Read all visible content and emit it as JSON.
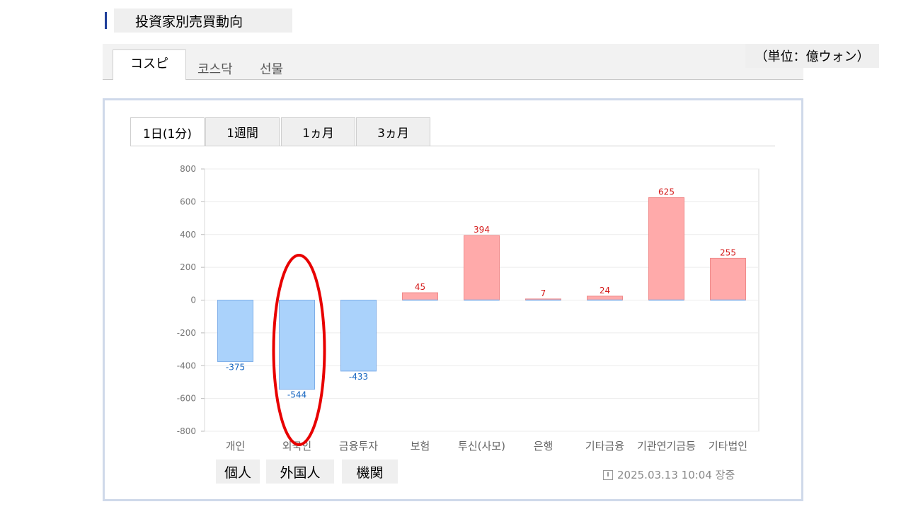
{
  "header": {
    "title": "投資家別売買動向"
  },
  "market_tabs": [
    {
      "label": "コスピ",
      "active": true
    },
    {
      "label": "코스닥",
      "active": false
    },
    {
      "label": "선물",
      "active": false
    }
  ],
  "unit_label": "（単位：億ウォン）",
  "period_tabs": [
    {
      "label": "1日(1分)",
      "active": true
    },
    {
      "label": "1週間",
      "active": false
    },
    {
      "label": "1ヵ月",
      "active": false
    },
    {
      "label": "3ヵ月",
      "active": false
    }
  ],
  "chart_data": {
    "type": "bar",
    "categories": [
      "개인",
      "외국인",
      "금융투자",
      "보험",
      "투신(사모)",
      "은행",
      "기타금융",
      "기관연기금등",
      "기타법인"
    ],
    "values": [
      -375,
      -544,
      -433,
      45,
      394,
      7,
      24,
      625,
      255
    ],
    "ylim": [
      -800,
      800
    ],
    "yticks": [
      800,
      600,
      400,
      200,
      0,
      -200,
      -400,
      -600,
      -800
    ],
    "grid": true,
    "colors": {
      "positive_fill": "#ffaaaa",
      "positive_stroke": "#f08a8a",
      "negative_fill": "#aad2fb",
      "negative_stroke": "#7eaee8",
      "positive_label": "#d41a1a",
      "negative_label": "#1565c0"
    }
  },
  "annotations": {
    "highlight_category": "외국인",
    "highlight_color": "#e80000",
    "group_labels": [
      "個人",
      "外国人",
      "機関"
    ]
  },
  "timestamp": "2025.03.13 10:04 장중"
}
